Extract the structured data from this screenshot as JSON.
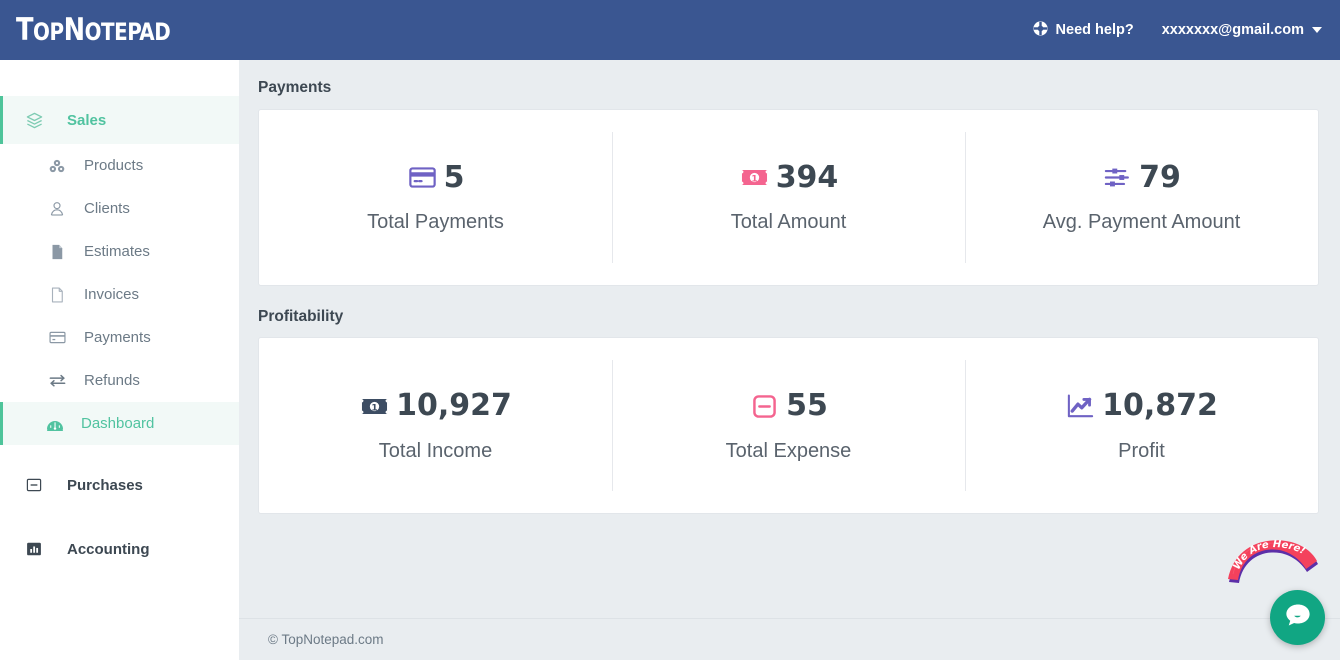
{
  "header": {
    "logo_top": "Top",
    "logo_note": "Notepad",
    "logo_full": "TopNotepad",
    "help_label": "Need help?",
    "help_icon": "lifebuoy-icon",
    "user_email": "xxxxxxx@gmail.com",
    "caret_icon": "chevron-down-icon",
    "bg_color": "#3a5691"
  },
  "sidebar": {
    "groups": [
      {
        "label": "Sales",
        "icon": "layers-icon",
        "active": true,
        "items": [
          {
            "label": "Products",
            "icon": "products-icon",
            "active": false
          },
          {
            "label": "Clients",
            "icon": "user-icon",
            "active": false
          },
          {
            "label": "Estimates",
            "icon": "document-filled-icon",
            "active": false
          },
          {
            "label": "Invoices",
            "icon": "document-icon",
            "active": false
          },
          {
            "label": "Payments",
            "icon": "credit-card-icon",
            "active": false
          },
          {
            "label": "Refunds",
            "icon": "exchange-arrows-icon",
            "active": false
          },
          {
            "label": "Dashboard",
            "icon": "speedometer-icon",
            "active": true
          }
        ]
      },
      {
        "label": "Purchases",
        "icon": "minus-square-icon",
        "active": false,
        "items": []
      },
      {
        "label": "Accounting",
        "icon": "bar-chart-icon",
        "active": false,
        "items": []
      }
    ],
    "active_color": "#51c3a0",
    "active_bg": "#f2f9f7"
  },
  "main": {
    "sections": [
      {
        "title": "Payments",
        "stats": [
          {
            "value": "5",
            "label": "Total Payments",
            "icon": "credit-card-icon",
            "icon_color": "#6f62c4"
          },
          {
            "value": "394",
            "label": "Total Amount",
            "icon": "banknote-icon",
            "icon_color": "#f4648f"
          },
          {
            "value": "79",
            "label": "Avg. Payment Amount",
            "icon": "sliders-icon",
            "icon_color": "#6f62c4"
          }
        ]
      },
      {
        "title": "Profitability",
        "stats": [
          {
            "value": "10,927",
            "label": "Total Income",
            "icon": "banknote-dark-icon",
            "icon_color": "#3d4d63"
          },
          {
            "value": "55",
            "label": "Total Expense",
            "icon": "minus-rounded-icon",
            "icon_color": "#f4648f"
          },
          {
            "value": "10,872",
            "label": "Profit",
            "icon": "trending-up-icon",
            "icon_color": "#6f62c4"
          }
        ]
      }
    ]
  },
  "footer": {
    "copyright": "© TopNotepad.com"
  },
  "chat": {
    "badge_text": "We Are Here!",
    "badge_color": "#f4415c",
    "bubble_color": "#11a683",
    "bubble_icon": "chat-bubble-icon"
  }
}
